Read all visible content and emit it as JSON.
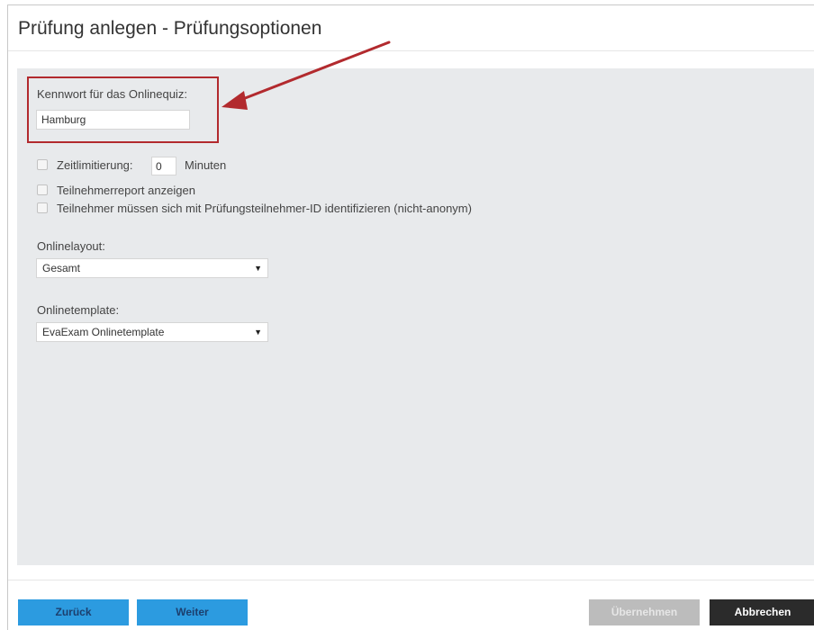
{
  "dialog": {
    "title": "Prüfung anlegen - Prüfungsoptionen"
  },
  "password": {
    "label": "Kennwort für das Onlinequiz:",
    "value": "Hamburg"
  },
  "options": {
    "time_limit_label": "Zeitlimitierung:",
    "time_limit_value": "0",
    "time_limit_unit": "Minuten",
    "participant_report_label": "Teilnehmerreport anzeigen",
    "identify_label": "Teilnehmer müssen sich mit Prüfungsteilnehmer-ID identifizieren (nicht-anonym)"
  },
  "layout": {
    "label": "Onlinelayout:",
    "selected": "Gesamt"
  },
  "template": {
    "label": "Onlinetemplate:",
    "selected": "EvaExam Onlinetemplate"
  },
  "buttons": {
    "back": "Zurück",
    "next": "Weiter",
    "apply": "Übernehmen",
    "cancel": "Abbrechen"
  },
  "colors": {
    "annotation": "#b22a2e",
    "button_primary": "#2c9be0",
    "button_dark": "#2b2b2b",
    "content_bg": "#e8eaec"
  }
}
